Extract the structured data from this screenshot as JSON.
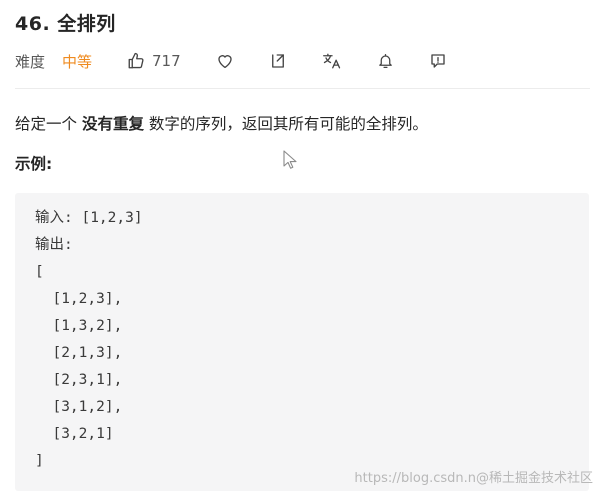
{
  "problem": {
    "title": "46. 全排列",
    "difficulty_label": "难度",
    "difficulty_value": "中等",
    "like_count": "717"
  },
  "icons": [
    "thumbs-up-icon",
    "heart-icon",
    "share-icon",
    "translate-icon",
    "bell-icon",
    "feedback-icon",
    "cursor-icon"
  ],
  "colors": {
    "difficulty_medium": "#ef8b20",
    "code_background": "#f5f5f6",
    "text_primary": "#262626"
  },
  "description": {
    "before": "给定一个 ",
    "emphasis": "没有重复",
    "after": " 数字的序列，返回其所有可能的全排列。"
  },
  "example": {
    "heading": "示例:",
    "lines": [
      "输入: [1,2,3]",
      "输出:",
      "[",
      "  [1,2,3],",
      "  [1,3,2],",
      "  [2,1,3],",
      "  [2,3,1],",
      "  [3,1,2],",
      "  [3,2,1]",
      "]"
    ]
  },
  "watermark": "https://blog.csdn.n@稀土掘金技术社区"
}
